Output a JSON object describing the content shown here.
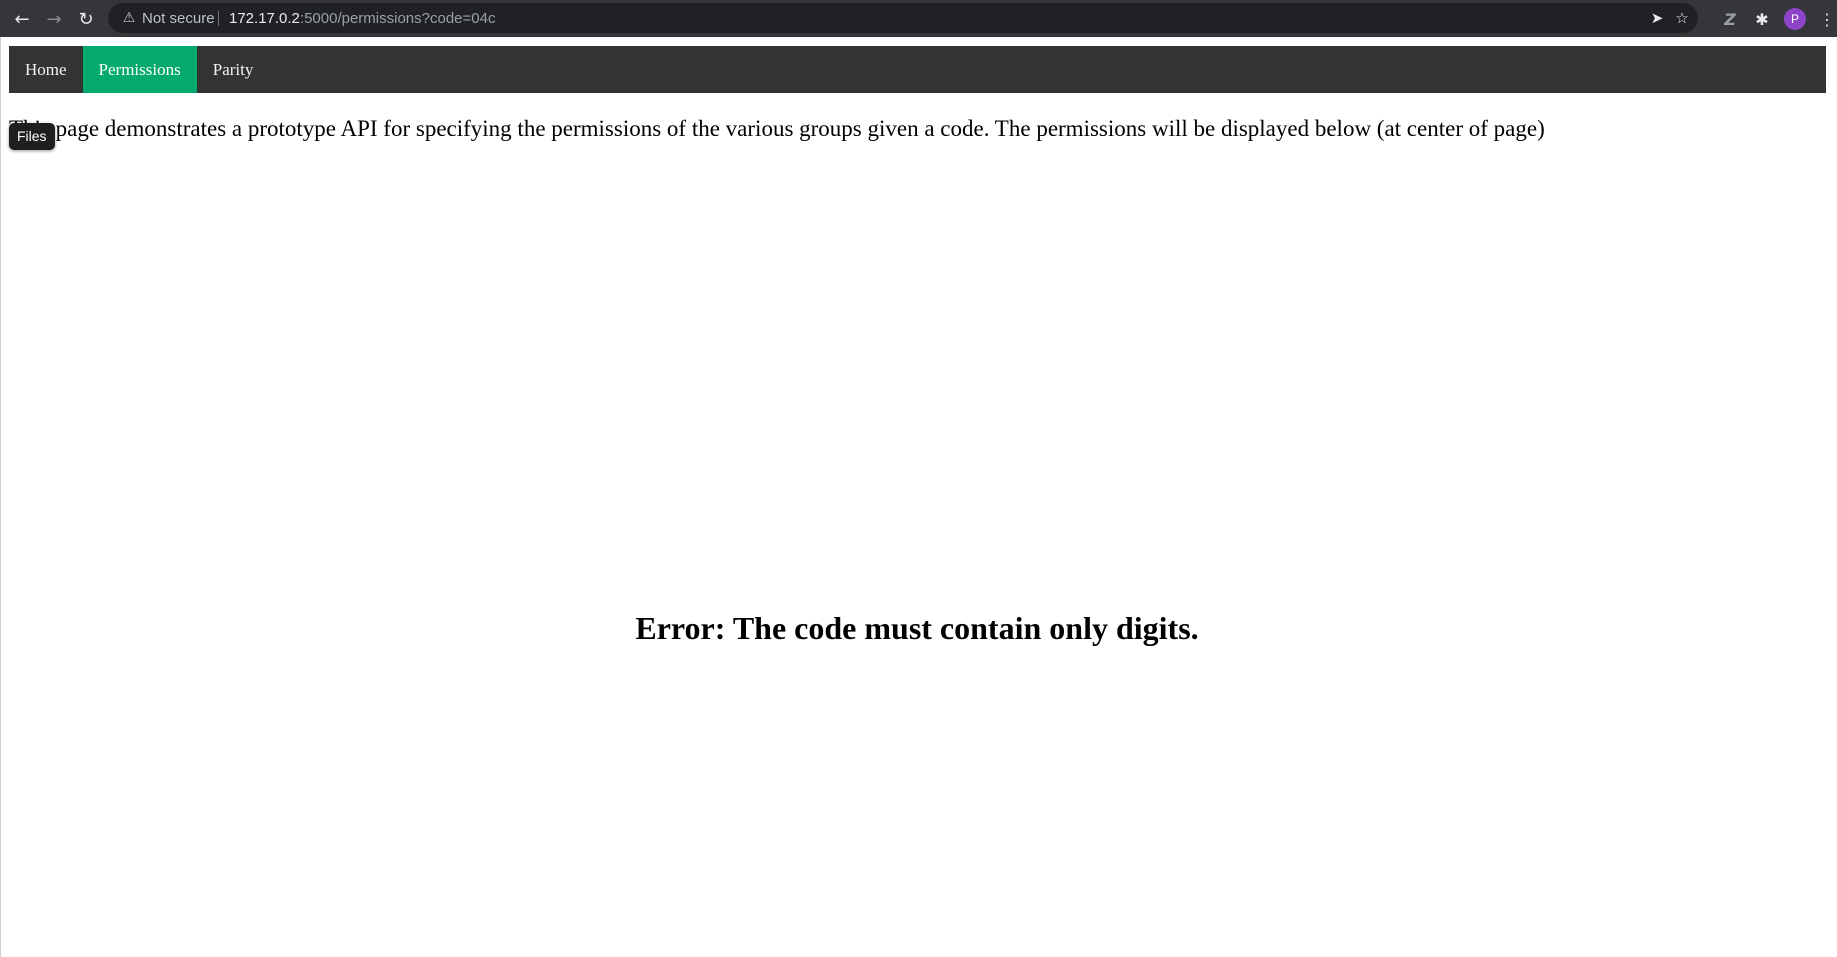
{
  "browser": {
    "security_label": "Not secure",
    "url_host": "172.17.0.2",
    "url_rest": ":5000/permissions?code=04c",
    "avatar_letter": "P",
    "icons": {
      "back": "back-arrow-icon",
      "forward": "forward-arrow-icon",
      "reload": "reload-icon",
      "warning": "warning-triangle-icon",
      "send": "send-icon",
      "bookmark": "star-icon",
      "extension_z": "z-extension-icon",
      "extensions": "puzzle-icon",
      "menu": "kebab-menu-icon"
    }
  },
  "nav": {
    "items": [
      {
        "label": "Home",
        "active": false
      },
      {
        "label": "Permissions",
        "active": true
      },
      {
        "label": "Parity",
        "active": false
      }
    ],
    "active_color": "#04AA6D",
    "bar_color": "#333333"
  },
  "main": {
    "intro": "This page demonstrates a prototype API for specifying the permissions of the various groups given a code. The permissions will be displayed below (at center of page)",
    "error": "Error: The code must contain only digits."
  },
  "tooltip": {
    "label": "Files"
  }
}
